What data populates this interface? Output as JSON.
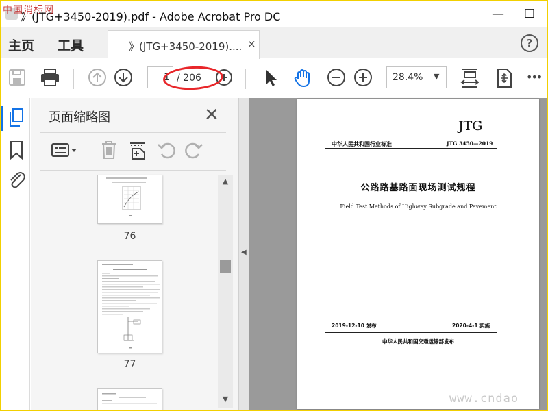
{
  "window": {
    "title": "》(JTG+3450-2019).pdf - Adobe Acrobat Pro DC",
    "watermark_top": "中国消标网",
    "minimize_glyph": "—",
    "maximize_glyph": "☐"
  },
  "menu": {
    "home": "主页",
    "tools": "工具"
  },
  "tab": {
    "label": "》(JTG+3450-2019)....",
    "close": "×"
  },
  "help": "?",
  "toolbar": {
    "page_current": "1",
    "page_total": "/ 206",
    "zoom": "28.4%",
    "zoom_caret": "▼",
    "more": "•••"
  },
  "annotation": {
    "color": "#e8262a"
  },
  "thumbnails_panel": {
    "title": "页面缩略图",
    "close": "✕",
    "pages": [
      "76",
      "77"
    ]
  },
  "document": {
    "std_code": "JTG",
    "header_left": "中华人民共和国行业标准",
    "header_right": "JTG 3450—2019",
    "title_cn": "公路路基路面现场测试规程",
    "title_en": "Field Test Methods of Highway Subgrade and Pavement",
    "issue_date": "2019-12-10 发布",
    "impl_date": "2020-4-1 实施",
    "publisher": "中华人民共和国交通运输部发布"
  },
  "watermark_bottom": "www.cndao",
  "colors": {
    "accent": "#1473e6",
    "border": "#f2d000"
  }
}
